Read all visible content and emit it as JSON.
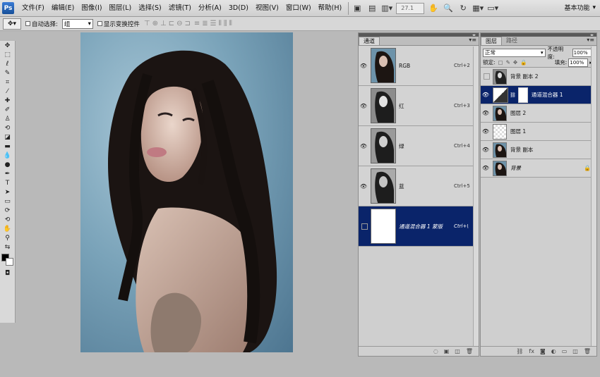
{
  "app": {
    "logo": "Ps",
    "workspace_label": "基本功能"
  },
  "menu": [
    "文件(F)",
    "编辑(E)",
    "图像(I)",
    "图层(L)",
    "选择(S)",
    "滤镜(T)",
    "分析(A)",
    "3D(D)",
    "视图(V)",
    "窗口(W)",
    "帮助(H)"
  ],
  "menubar_tools": {
    "zoom_value": "27.1"
  },
  "options": {
    "auto_select_label": "自动选择:",
    "auto_select_value": "组",
    "show_transform_label": "显示变换控件"
  },
  "channels_panel": {
    "tabs": [
      "通道"
    ],
    "rows": [
      {
        "name": "RGB",
        "shortcut": "Ctrl+2"
      },
      {
        "name": "红",
        "shortcut": "Ctrl+3"
      },
      {
        "name": "绿",
        "shortcut": "Ctrl+4"
      },
      {
        "name": "蓝",
        "shortcut": "Ctrl+5"
      },
      {
        "name": "通道混合器 1 蒙版",
        "shortcut": "Ctrl+\\"
      }
    ]
  },
  "layers_panel": {
    "tabs": [
      "图层",
      "路径"
    ],
    "blend_mode": "正常",
    "opacity_label": "不透明度:",
    "opacity_value": "100%",
    "lock_label": "锁定:",
    "fill_label": "填充:",
    "fill_value": "100%",
    "layers": [
      {
        "name": "背景 副本 2"
      },
      {
        "name": "通道混合器 1"
      },
      {
        "name": "图层 2"
      },
      {
        "name": "图层 1"
      },
      {
        "name": "背景 副本"
      },
      {
        "name": "背景"
      }
    ]
  },
  "colors": {
    "selection": "#0a246a",
    "panel_bg": "#cfcfcf",
    "app_bg": "#b9b9b9"
  }
}
